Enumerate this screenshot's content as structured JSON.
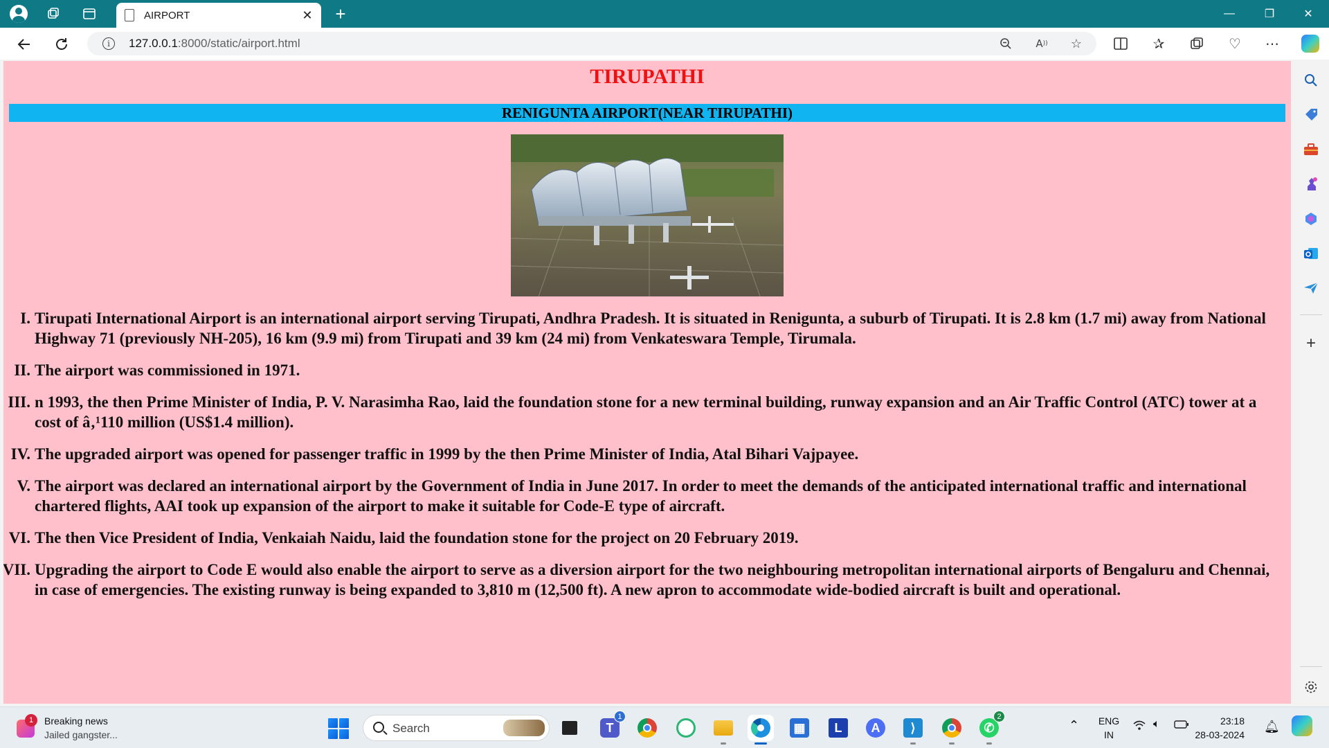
{
  "browser": {
    "tab_title": "AIRPORT",
    "tab_close": "✕",
    "new_tab": "+",
    "url_host": "127.0.0.1",
    "url_path": ":8000/static/airport.html",
    "window_controls": {
      "minimize": "—",
      "restore": "❐",
      "close": "✕"
    },
    "icons": [
      "back-icon",
      "refresh-icon",
      "info-icon",
      "zoom-icon",
      "read-aloud-icon",
      "favorite-star-icon",
      "split-screen-icon",
      "favorites-icon",
      "collections-icon",
      "browser-essentials-icon",
      "more-icon",
      "copilot-icon"
    ]
  },
  "page": {
    "title": "TIRUPATHI",
    "subtitle": "RENIGUNTA AIRPORT(NEAR TIRUPATHI)",
    "title_color": "#ee1111",
    "subtitle_bar_color": "#10b4f0",
    "background_color": "#ffc0cb",
    "facts": [
      {
        "num": "I.",
        "text": "Tirupati International Airport is an international airport serving Tirupati, Andhra Pradesh. It is situated in Renigunta, a suburb of Tirupati. It is 2.8 km (1.7 mi) away from National Highway 71 (previously NH-205), 16 km (9.9 mi) from Tirupati and 39 km (24 mi) from Venkateswara Temple, Tirumala."
      },
      {
        "num": "II.",
        "text": "The airport was commissioned in 1971."
      },
      {
        "num": "III.",
        "text": "n 1993, the then Prime Minister of India, P. V. Narasimha Rao, laid the foundation stone for a new terminal building, runway expansion and an Air Traffic Control (ATC) tower at a cost of â‚¹110 million (US$1.4 million)."
      },
      {
        "num": "IV.",
        "text": "The upgraded airport was opened for passenger traffic in 1999 by the then Prime Minister of India, Atal Bihari Vajpayee."
      },
      {
        "num": "V.",
        "text": "The airport was declared an international airport by the Government of India in June 2017. In order to meet the demands of the anticipated international traffic and international chartered flights, AAI took up expansion of the airport to make it suitable for Code-E type of aircraft."
      },
      {
        "num": "VI.",
        "text": "The then Vice President of India, Venkaiah Naidu, laid the foundation stone for the project on 20 February 2019."
      },
      {
        "num": "VII.",
        "text": "Upgrading the airport to Code E would also enable the airport to serve as a diversion airport for the two neighbouring metropolitan international airports of Bengaluru and Chennai, in case of emergencies. The existing runway is being expanded to 3,810 m (12,500 ft). A new apron to accommodate wide-bodied aircraft is built and operational."
      }
    ]
  },
  "sidebar": {
    "icons": [
      "search-icon",
      "shopping-icon",
      "tools-icon",
      "games-icon",
      "microsoft-365-icon",
      "outlook-icon",
      "drop-icon",
      "add-icon",
      "settings-icon"
    ]
  },
  "taskbar": {
    "news_title": "Breaking news",
    "news_subtitle": "Jailed gangster...",
    "news_badge": "1",
    "search_placeholder": "Search",
    "teams_badge": "1",
    "whatsapp_badge": "2",
    "lang_line1": "ENG",
    "lang_line2": "IN",
    "time": "23:18",
    "date": "28-03-2024"
  }
}
